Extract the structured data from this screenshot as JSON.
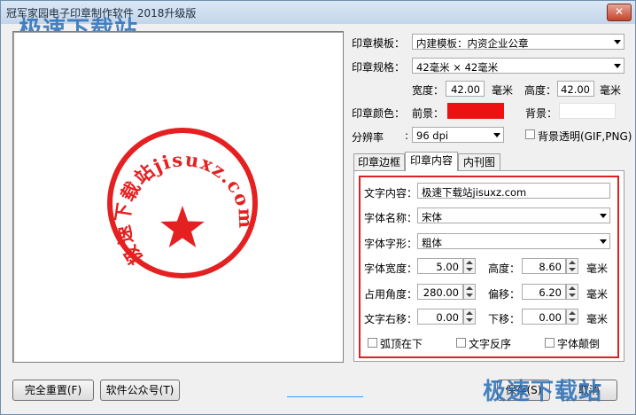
{
  "window": {
    "title": "冠军家园电子印章制作软件 2018升级版",
    "close_glyph": "✕"
  },
  "watermarks": {
    "top_left": "极速下载站",
    "bottom_right": "极速下载站"
  },
  "stamp": {
    "arc_text": "极速下载站jisuxz.com",
    "color": "#e52020",
    "center_icon": "star-icon"
  },
  "settings": {
    "template_label": "印章模板：",
    "template_value": "内建模板：内资企业公章",
    "spec_label": "印章规格：",
    "spec_value": "42毫米 × 42毫米",
    "width_label": "宽度：",
    "width_value": "42.00",
    "width_unit": "毫米",
    "height_label": "高度：",
    "height_value": "42.00",
    "height_unit": "毫米",
    "color_label": "印章颜色：",
    "foreground_label": "前景：",
    "foreground_color": "#ee1111",
    "background_label": "背景：",
    "background_color": "#ffffff",
    "resolution_label": "分辨率",
    "resolution_sep": ":",
    "resolution_value": "96 dpi",
    "transparent_label": "背景透明(GIF,PNG)"
  },
  "tabs": [
    {
      "label": "印章边框"
    },
    {
      "label": "印章内容"
    },
    {
      "label": "内刊图"
    }
  ],
  "content": {
    "text_label": "文字内容：",
    "text_value": "极速下载站jisuxz.com",
    "font_name_label": "字体名称：",
    "font_name_value": "宋体",
    "font_style_label": "字体字形：",
    "font_style_value": "粗体",
    "font_width_label": "字体宽度：",
    "font_width_value": "5.00",
    "font_height_label": "高度：",
    "font_height_value": "8.60",
    "font_height_unit": "毫米",
    "angle_label": "占用角度：",
    "angle_value": "280.00",
    "offset_label": "偏移：",
    "offset_value": "6.20",
    "offset_unit": "毫米",
    "right_shift_label": "文字右移：",
    "right_shift_value": "0.00",
    "down_shift_label": "下移：",
    "down_shift_value": "0.00",
    "down_shift_unit": "毫米",
    "arc_top_label": "弧顶在下",
    "reverse_label": "文字反序",
    "upside_down_label": "字体颠倒"
  },
  "buttons": {
    "reset": "完全重置(F)",
    "wechat": "软件公众号(T)",
    "save": "保存(S)",
    "cancel": "取消"
  }
}
